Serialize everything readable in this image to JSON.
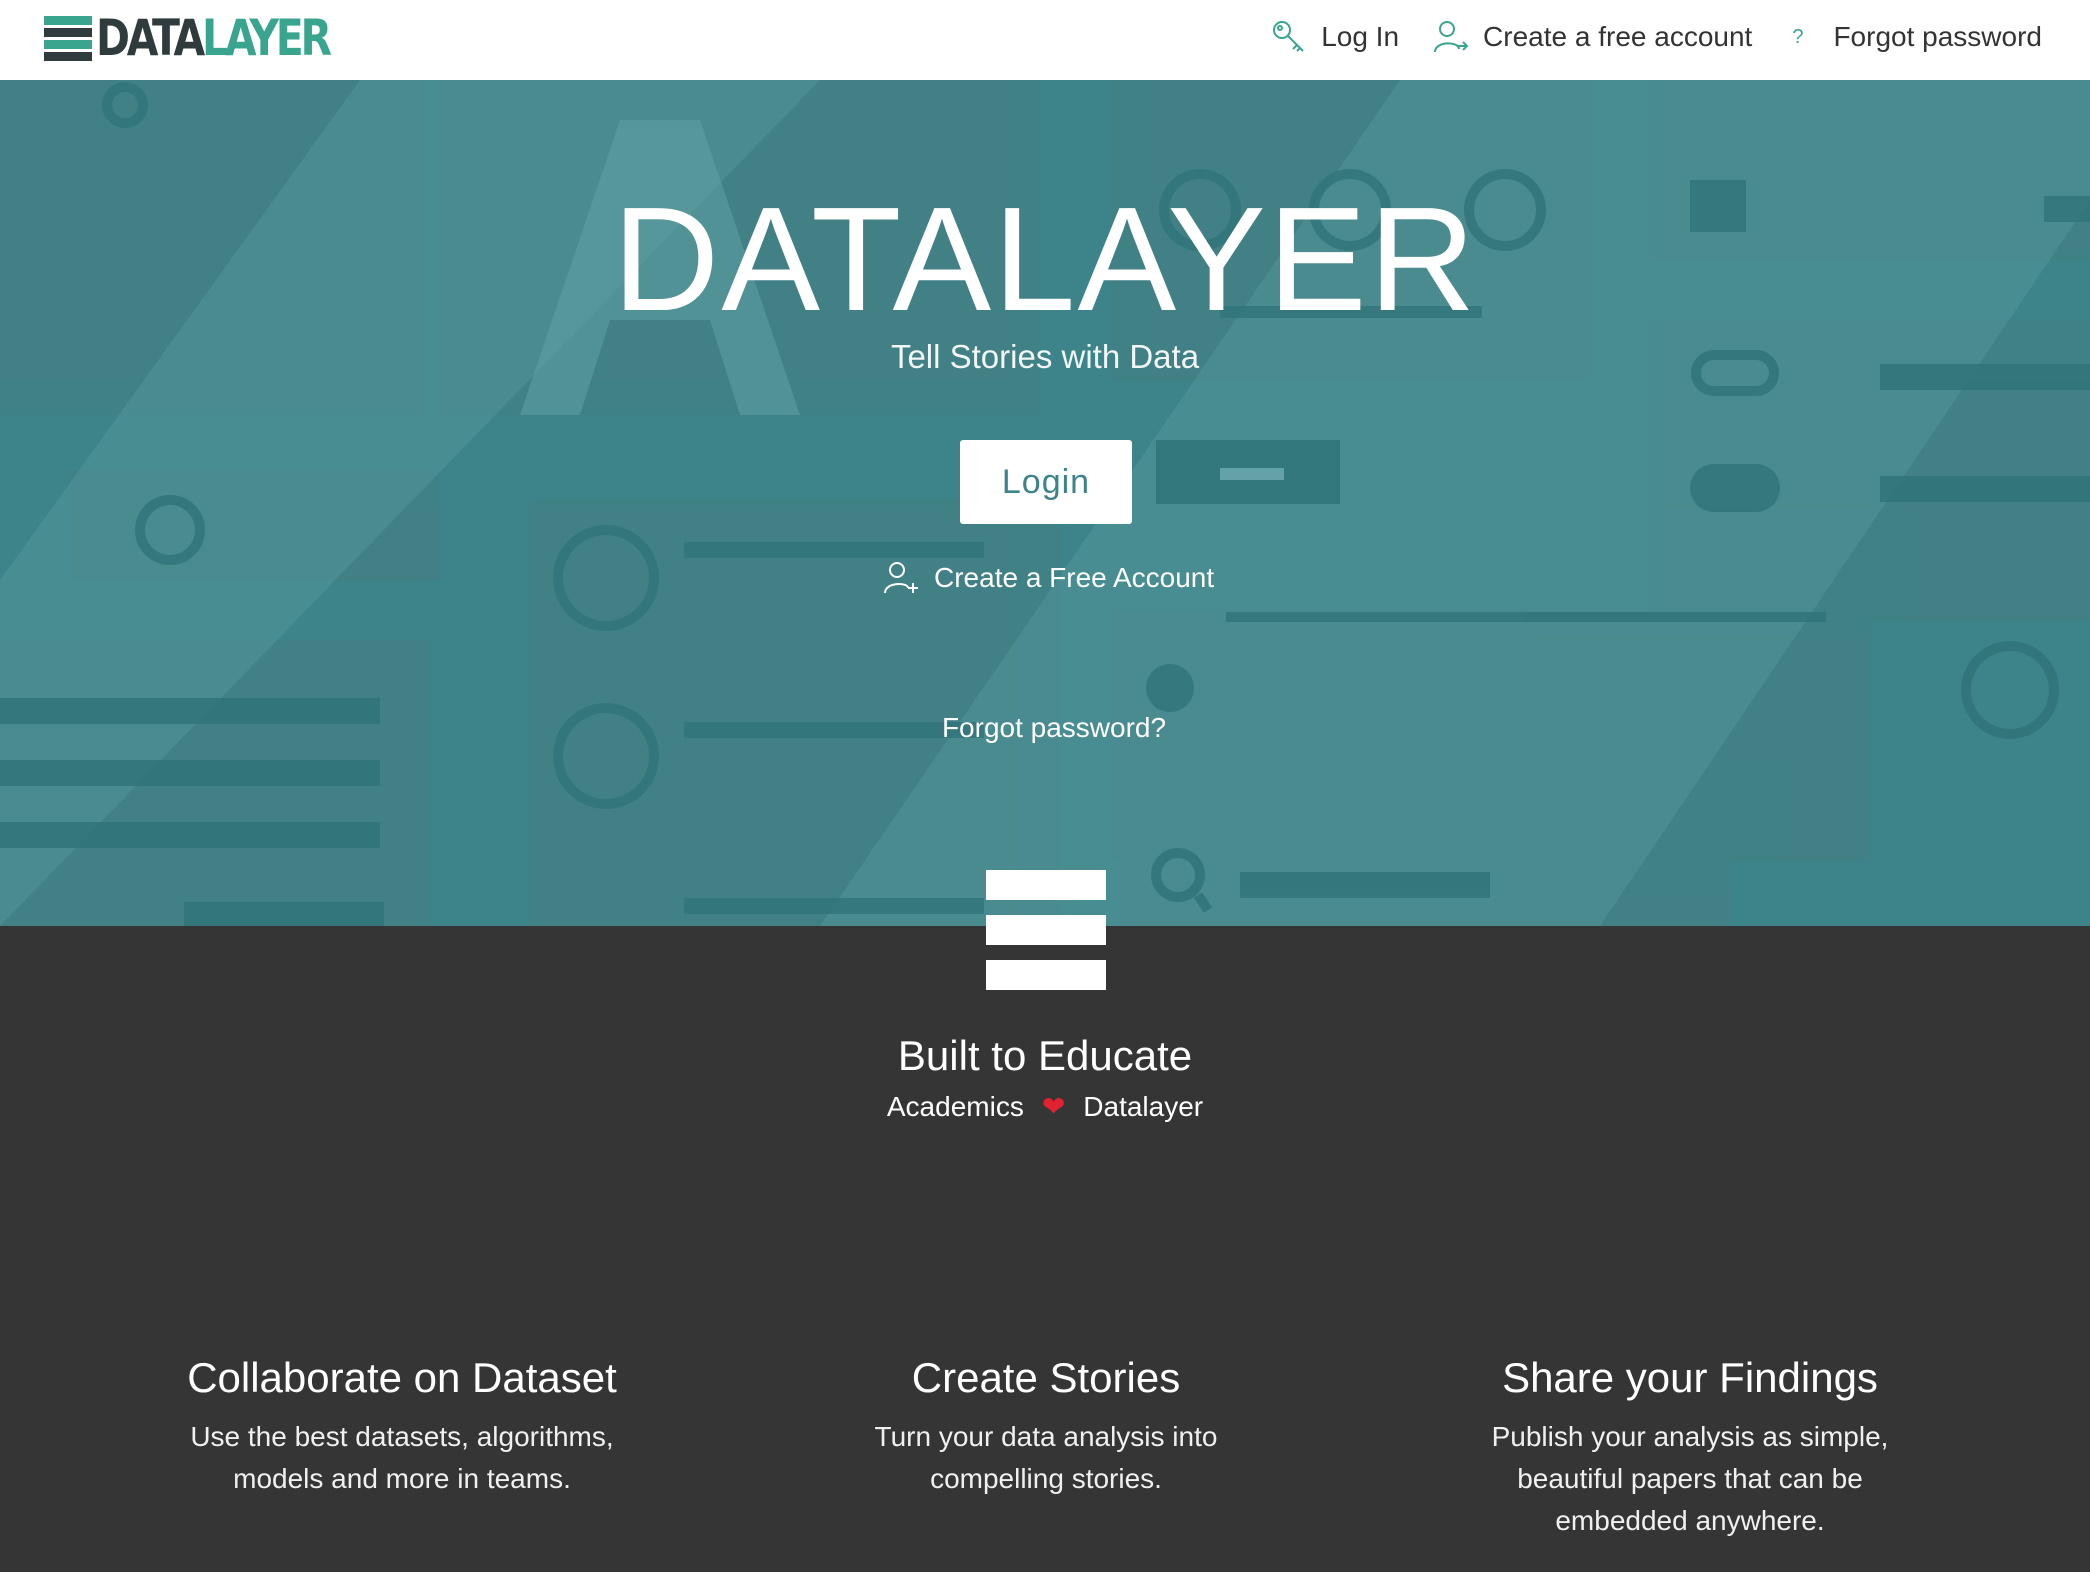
{
  "brand": {
    "logo_text_dark": "DATA",
    "logo_text_accent": "LAYER",
    "accent_color": "#3aa58f",
    "hero_color": "#3c8489",
    "dark_bg": "#353535"
  },
  "nav": {
    "login": {
      "label": "Log In",
      "icon": "key-icon"
    },
    "create_account": {
      "label": "Create a free account",
      "icon": "add-user-icon"
    },
    "forgot": {
      "label": "Forgot password",
      "icon": "question-icon",
      "glyph": "?"
    }
  },
  "hero": {
    "title": "DATALAYER",
    "subtitle": "Tell Stories with Data",
    "login_button": "Login",
    "create_account_link": "Create a Free Account",
    "forgot_password_link": "Forgot password?"
  },
  "education": {
    "title": "Built to Educate",
    "left": "Academics",
    "heart": "❤",
    "right": "Datalayer"
  },
  "features": [
    {
      "title": "Collaborate on Dataset",
      "line1": "Use the best datasets, algorithms,",
      "line2": "models and more in teams.",
      "line3": ""
    },
    {
      "title": "Create Stories",
      "line1": "Turn your data analysis into",
      "line2": "compelling stories.",
      "line3": ""
    },
    {
      "title": "Share your Findings",
      "line1": "Publish your analysis as simple,",
      "line2": "beautiful papers that can be",
      "line3": "embedded anywhere."
    }
  ]
}
